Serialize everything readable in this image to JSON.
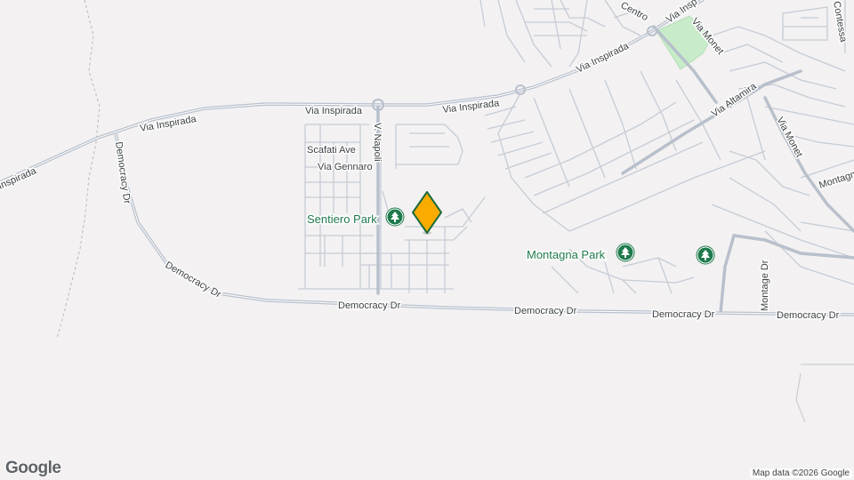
{
  "map": {
    "roads": {
      "via_inspirada": "Via Inspirada",
      "democracy_dr": "Democracy Dr",
      "via_napoli": "V. Napoli",
      "scafati_ave": "Scafati Ave",
      "via_gennaro": "Via Gennaro",
      "via_monet": "Via Monet",
      "via_altamira": "Via Altamira",
      "montage_dr": "Montage Dr",
      "contessa": "Contessa",
      "centro": "Centro",
      "inspirada_partial": "Via Insp",
      "inspirada_left": "Inspirada",
      "montagna_partial": "Montagn"
    },
    "parks": {
      "sentiero": "Sentiero Park",
      "montagna": "Montagna Park"
    },
    "icons": {
      "park": "tree-icon",
      "marker": "location-pin-icon"
    },
    "colors": {
      "background": "#f3f1f2",
      "road": "#c6ccd6",
      "park_green": "#1e7a4c",
      "marker_fill": "#f9ab00",
      "marker_stroke": "#1e6b3a"
    }
  },
  "footer": {
    "logo": "Google",
    "attribution": "Map data ©2026 Google"
  }
}
